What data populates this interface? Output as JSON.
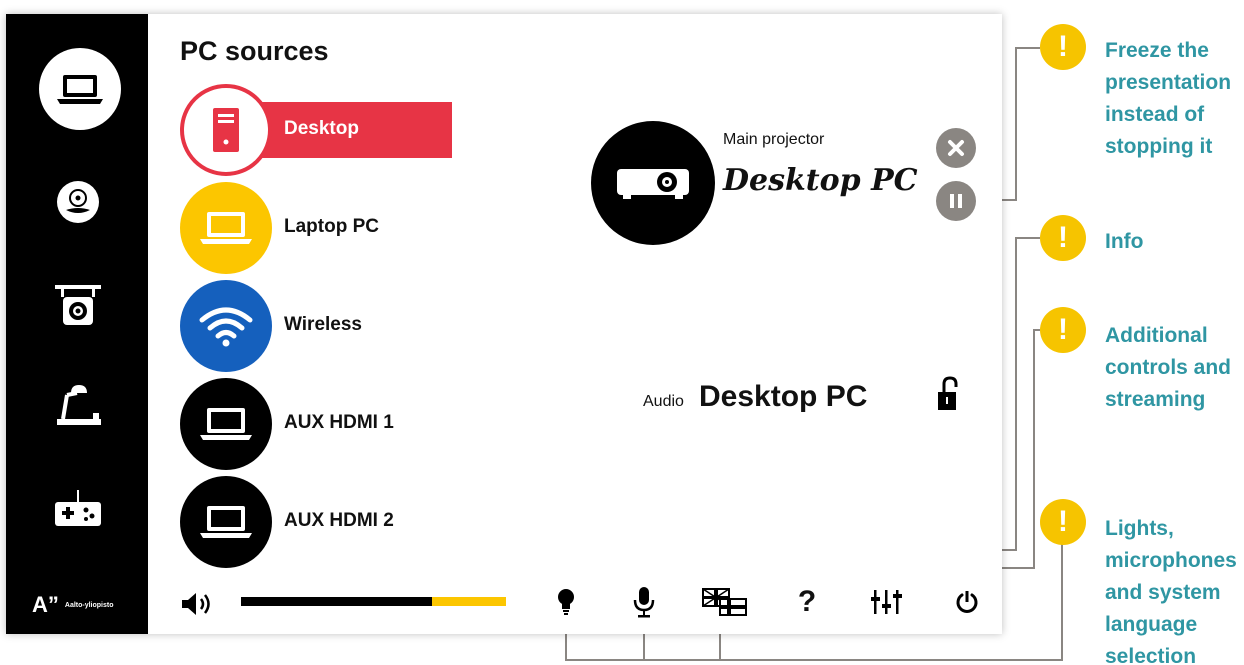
{
  "sidebar": {
    "items": [
      {
        "icon": "laptop-icon",
        "active": true
      },
      {
        "icon": "disc-icon",
        "active": false
      },
      {
        "icon": "document-camera-icon",
        "active": false
      },
      {
        "icon": "lamp-icon",
        "active": false
      },
      {
        "icon": "gamepad-icon",
        "active": false
      }
    ],
    "logo": {
      "mark": "A”",
      "text": "Aalto-yliopisto"
    }
  },
  "pc_sources": {
    "title": "PC sources",
    "items": [
      {
        "label": "Desktop",
        "icon": "desktop-tower-icon",
        "selected": true,
        "color": "#e73445"
      },
      {
        "label": "Laptop PC",
        "icon": "laptop-icon",
        "selected": false,
        "color": "#fcc600"
      },
      {
        "label": "Wireless",
        "icon": "wifi-icon",
        "selected": false,
        "color": "#1560bd"
      },
      {
        "label": "AUX HDMI 1",
        "icon": "laptop-icon",
        "selected": false,
        "color": "#000000"
      },
      {
        "label": "AUX HDMI 2",
        "icon": "laptop-icon",
        "selected": false,
        "color": "#000000"
      }
    ]
  },
  "projector": {
    "title": "Main projector",
    "source": "Desktop PC",
    "icon": "projector-icon"
  },
  "audio": {
    "label": "Audio",
    "source": "Desktop PC",
    "lock_icon": "unlock-icon"
  },
  "volume": {
    "level": 0.72,
    "fill_color": "#000000",
    "track_color": "#fcc600"
  },
  "bottom_bar": {
    "buttons": [
      {
        "name": "lights",
        "icon": "lightbulb-icon"
      },
      {
        "name": "microphone",
        "icon": "microphone-icon"
      },
      {
        "name": "language",
        "icon": "flags-icon"
      },
      {
        "name": "info",
        "icon": "question-icon",
        "text": "?"
      },
      {
        "name": "mixer",
        "icon": "sliders-icon"
      },
      {
        "name": "power",
        "icon": "power-icon"
      }
    ]
  },
  "callouts": [
    {
      "icon": "exclamation-icon",
      "mark": "!",
      "text": "Freeze the\npresentation\ninstead of\nstopping it"
    },
    {
      "icon": "exclamation-icon",
      "mark": "!",
      "text": "Info"
    },
    {
      "icon": "exclamation-icon",
      "mark": "!",
      "text": "Additional\ncontrols and\nstreaming"
    },
    {
      "icon": "exclamation-icon",
      "mark": "!",
      "text": "Lights,\nmicrophones\nand system\nlanguage\nselection"
    }
  ],
  "colors": {
    "accent_red": "#e73445",
    "accent_yellow": "#fcc600",
    "wireless_blue": "#1560bd",
    "callout_text": "#2f96a3",
    "callout_dot": "#f6c400",
    "button_gray": "#8a8682"
  }
}
